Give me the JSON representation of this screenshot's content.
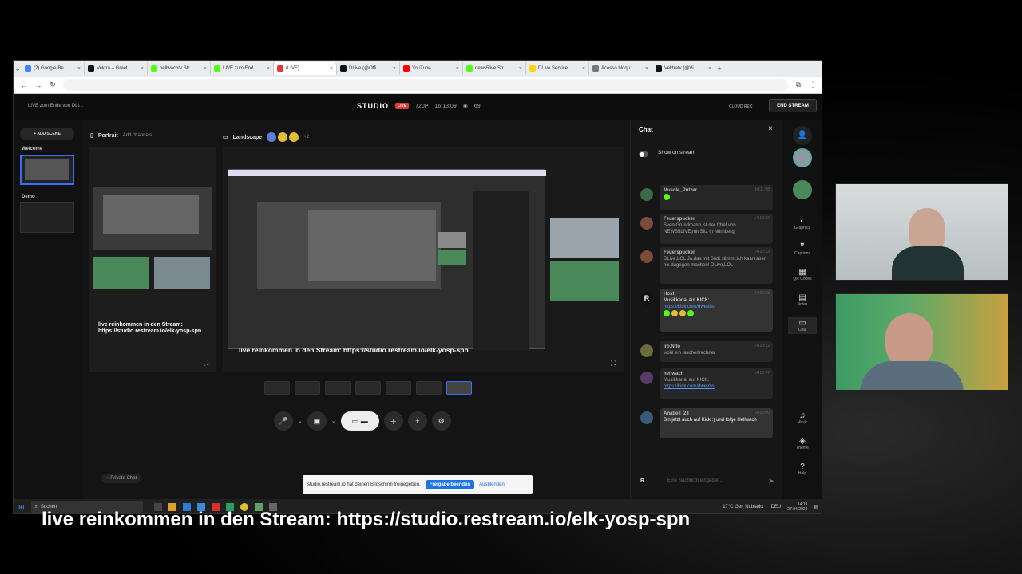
{
  "browser": {
    "tabs": [
      {
        "label": "(2) Google-Be...",
        "color": "#4285f4"
      },
      {
        "label": "Vektra – Greet",
        "color": "#111111"
      },
      {
        "label": "hellwachtv Str...",
        "color": "#53fc18"
      },
      {
        "label": "LIVE zum End...",
        "color": "#53fc18"
      },
      {
        "label": "(LIVE)",
        "color": "#e53935",
        "active": true
      },
      {
        "label": "DLive (@Offi...",
        "color": "#111111"
      },
      {
        "label": "YouTube",
        "color": "#ff0000"
      },
      {
        "label": "news5live Str...",
        "color": "#53fc18"
      },
      {
        "label": "DLive Service",
        "color": "#ffd400"
      },
      {
        "label": "Acesso bloqu...",
        "color": "#777777"
      },
      {
        "label": "Vektratv (@Vi...",
        "color": "#111111"
      }
    ],
    "new_tab": "+",
    "url": "——————————————————"
  },
  "studio": {
    "stream_title": "LIVE zum Ende von DLI...",
    "logo": "STUDIO",
    "live": "LIVE",
    "resolution": "720P",
    "timer": "16:13:09",
    "viewers": "69",
    "cloud_rec": "CLOUD REC",
    "end_stream": "END STREAM"
  },
  "scenes": {
    "add_scene": "+ ADD SCENE",
    "items": [
      {
        "label": "Welcome"
      },
      {
        "label": "Demo"
      }
    ]
  },
  "canvas": {
    "portrait_label": "Portrait",
    "add_channels": "Add channels",
    "landscape_label": "Landscape",
    "extra_count": "+2",
    "portrait_overlay": "live reinkommen in den Stream: https://studio.restream.io/elk-yosp-spn",
    "landscape_overlay": "live reinkommen in den Stream: https://studio.restream.io/elk-yosp-spn",
    "private_chat": "Private Chat"
  },
  "chat": {
    "title": "Chat",
    "show_on_stream": "Show on stream",
    "messages": [
      {
        "name": "Muscle_Putzer",
        "text": "",
        "time": "14:11:58"
      },
      {
        "name": "Feuerspucker",
        "text": "Sven Grundmann,ist der Chef von NEWS5LIVE,mit Sitz in Nürnberg",
        "time": "14:12:06"
      },
      {
        "name": "Feuerspucker",
        "text": "DLive,LOL Ja,das mit Södi stimmt,ich kann aber nix dagegen machen! DLive,LOL",
        "time": "14:12:23"
      },
      {
        "name": "Host",
        "text": "Musikkanal auf KICK:",
        "link": "https://kick.com/dweebs",
        "time": "14:13:08"
      },
      {
        "name": "jro.Nito",
        "text": "wohl ein taschenrechner",
        "time": "14:13:32"
      },
      {
        "name": "hellwach",
        "text": "Musikkanal auf KICK:",
        "link": "https://kick.com/dweebs",
        "time": "14:13:47"
      },
      {
        "name": "Anabell_23",
        "text": "Bin jetzt auch auf Kick :) und folge Hellwach",
        "time": "14:13:50"
      }
    ],
    "input_placeholder": "Eine Nachricht eingeben..."
  },
  "rail": {
    "items": [
      "Graphics",
      "Captions",
      "QR Codes",
      "Notes",
      "Chat",
      "Music",
      "Theme",
      "Help"
    ]
  },
  "share": {
    "text": "studio.restream.io hat deinen Bildschirm freigegeben.",
    "stop": "Freigabe beenden",
    "hide": "Ausblenden"
  },
  "taskbar": {
    "search": "Suchen",
    "weather": "17°C  Ger. Nublado",
    "lang": "DEU",
    "time": "14:19",
    "date": "27.04.2024"
  },
  "caption": "live reinkommen in den Stream: https://studio.restream.io/elk-yosp-spn"
}
